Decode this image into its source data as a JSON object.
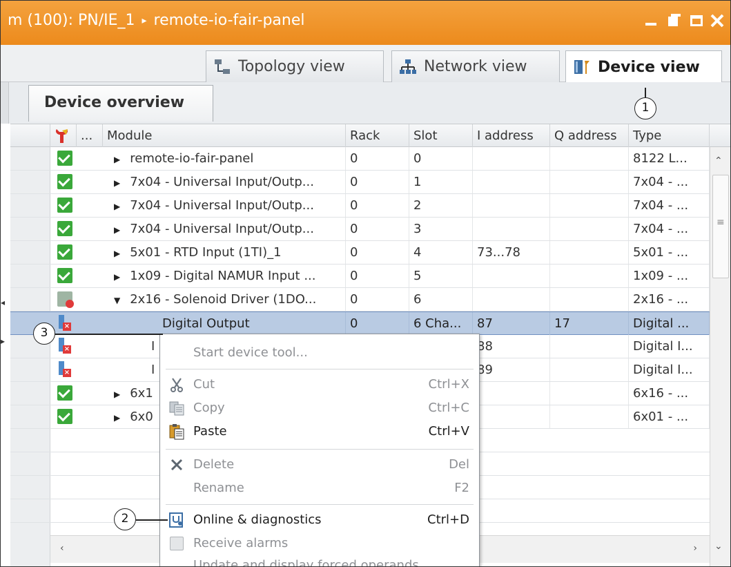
{
  "window": {
    "title_prefix": "m (100): PN/IE_1",
    "title_arrow": "▸",
    "title_device": "remote-io-fair-panel"
  },
  "views": {
    "topology": "Topology view",
    "network": "Network view",
    "device": "Device view"
  },
  "overview_tab": "Device overview",
  "columns": {
    "dots": "...",
    "module": "Module",
    "rack": "Rack",
    "slot": "Slot",
    "i_address": "I address",
    "q_address": "Q address",
    "type": "Type"
  },
  "rows": [
    {
      "status": "ok",
      "expand": "▶",
      "module": "remote-io-fair-panel",
      "rack": "0",
      "slot": "0",
      "iaddr": "",
      "qaddr": "",
      "type": "8122 L..."
    },
    {
      "status": "ok",
      "expand": "▶",
      "module": "7x04 - Universal Input/Outp...",
      "rack": "0",
      "slot": "1",
      "iaddr": "",
      "qaddr": "",
      "type": "7x04 - ..."
    },
    {
      "status": "ok",
      "expand": "▶",
      "module": "7x04 - Universal Input/Outp...",
      "rack": "0",
      "slot": "2",
      "iaddr": "",
      "qaddr": "",
      "type": "7x04 - ..."
    },
    {
      "status": "ok",
      "expand": "▶",
      "module": "7x04 - Universal Input/Outp...",
      "rack": "0",
      "slot": "3",
      "iaddr": "",
      "qaddr": "",
      "type": "7x04 - ..."
    },
    {
      "status": "ok",
      "expand": "▶",
      "module": "5x01 - RTD Input (1TI)_1",
      "rack": "0",
      "slot": "4",
      "iaddr": "73...78",
      "qaddr": "",
      "type": "5x01 - ..."
    },
    {
      "status": "ok",
      "expand": "▶",
      "module": "1x09 - Digital NAMUR Input ...",
      "rack": "0",
      "slot": "5",
      "iaddr": "",
      "qaddr": "",
      "type": "1x09 - ..."
    },
    {
      "status": "warn",
      "expand": "▼",
      "module": "2x16 - Solenoid Driver (1DO...",
      "rack": "0",
      "slot": "6",
      "iaddr": "",
      "qaddr": "",
      "type": "2x16 - ..."
    },
    {
      "status": "err",
      "expand": "",
      "module": "Digital Output",
      "rack": "0",
      "slot": "6 Cha...",
      "iaddr": "87",
      "qaddr": "17",
      "type": "Digital ..."
    },
    {
      "status": "err",
      "expand": "",
      "module": "I",
      "rack": "",
      "slot": "",
      "iaddr": "88",
      "qaddr": "",
      "type": "Digital I..."
    },
    {
      "status": "err",
      "expand": "",
      "module": "I",
      "rack": "",
      "slot": "",
      "iaddr": "89",
      "qaddr": "",
      "type": "Digital I..."
    },
    {
      "status": "ok",
      "expand": "▶",
      "module": "6x1",
      "rack": "",
      "slot": "",
      "iaddr": "",
      "qaddr": "",
      "type": "6x16 - ..."
    },
    {
      "status": "ok",
      "expand": "▶",
      "module": "6x0",
      "rack": "",
      "slot": "",
      "iaddr": "",
      "qaddr": "",
      "type": "6x01 - ..."
    }
  ],
  "context_menu": {
    "start_tool": "Start device tool...",
    "cut": "Cut",
    "cut_sc": "Ctrl+X",
    "copy": "Copy",
    "copy_sc": "Ctrl+C",
    "paste": "Paste",
    "paste_sc": "Ctrl+V",
    "delete": "Delete",
    "delete_sc": "Del",
    "rename": "Rename",
    "rename_sc": "F2",
    "online": "Online & diagnostics",
    "online_sc": "Ctrl+D",
    "alarms": "Receive alarms",
    "forced": "Update and display forced operands"
  },
  "callouts": {
    "c1": "1",
    "c2": "2",
    "c3": "3"
  },
  "colors": {
    "titlebar": "#ec8a1c",
    "selected_row": "#b9cbe3",
    "ok_status": "#3aa83a",
    "error_status": "#e03a3a"
  }
}
